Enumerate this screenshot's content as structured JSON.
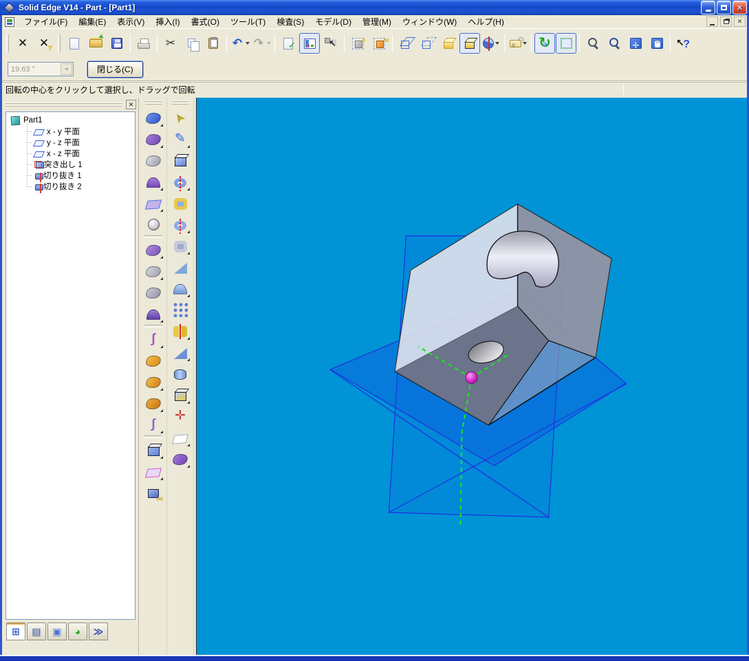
{
  "window": {
    "title": "Solid Edge V14 - Part - [Part1]",
    "controls": [
      "minimize",
      "maximize",
      "close"
    ]
  },
  "menu": {
    "items": [
      {
        "id": "file",
        "label": "ファイル(F)"
      },
      {
        "id": "edit",
        "label": "編集(E)"
      },
      {
        "id": "view",
        "label": "表示(V)"
      },
      {
        "id": "insert",
        "label": "挿入(I)"
      },
      {
        "id": "format",
        "label": "書式(O)"
      },
      {
        "id": "tools",
        "label": "ツール(T)"
      },
      {
        "id": "inspect",
        "label": "検査(S)"
      },
      {
        "id": "model",
        "label": "モデル(D)"
      },
      {
        "id": "manage",
        "label": "管理(M)"
      },
      {
        "id": "window",
        "label": "ウィンドウ(W)"
      },
      {
        "id": "help",
        "label": "ヘルプ(H)"
      }
    ],
    "mdi_controls": [
      "minimize",
      "restore",
      "close"
    ]
  },
  "toolbar": {
    "buttons": [
      {
        "n": "abort-command",
        "g": "✕",
        "c": "#111"
      },
      {
        "n": "abort-help",
        "g": "✕",
        "c": "#111",
        "sub": "?",
        "subc": "#D8A800"
      },
      {
        "grip": true
      },
      {
        "n": "new-document",
        "cls": "ic-new"
      },
      {
        "n": "open-document",
        "cls": "ic-open"
      },
      {
        "n": "save-document",
        "cls": "ic-save"
      },
      {
        "sep": true
      },
      {
        "n": "print",
        "cls": "ic-print"
      },
      {
        "sep": true
      },
      {
        "n": "cut",
        "g": "✂",
        "c": "#333"
      },
      {
        "n": "copy",
        "cls": "ic-copy"
      },
      {
        "n": "paste",
        "cls": "ic-paste"
      },
      {
        "sep": true
      },
      {
        "n": "undo",
        "g": "↶",
        "c": "#1f55d8",
        "dd": true
      },
      {
        "n": "redo",
        "g": "↷",
        "c": "#9b9b93",
        "dd": true,
        "disabled": true
      },
      {
        "sep": true
      },
      {
        "n": "document-check",
        "cls": "ic-doccheck"
      },
      {
        "n": "edgebar-toggle",
        "cls": "ic-edgebar",
        "pressed": true
      },
      {
        "n": "select-options",
        "cls": "ic-selboxes"
      },
      {
        "sep": true
      },
      {
        "n": "show-reference",
        "cls": "ic-showref"
      },
      {
        "n": "part-links",
        "cls": "ic-links"
      },
      {
        "sep": true
      },
      {
        "n": "wireframe-view",
        "cls": "ic-cubewire"
      },
      {
        "n": "hidden-line-view",
        "cls": "ic-cubehid"
      },
      {
        "n": "shaded-view",
        "cls": "ic-cubeshade"
      },
      {
        "n": "shaded-edges-view",
        "cls": "ic-cubeedges",
        "pressed": true
      },
      {
        "n": "section-view",
        "cls": "ic-section",
        "dd": true
      },
      {
        "sep": true
      },
      {
        "n": "callout",
        "cls": "ic-callout",
        "dd": true
      },
      {
        "sep": true
      },
      {
        "n": "rotate-view",
        "cls": "ic-rotate",
        "active": true
      },
      {
        "n": "view-orientation",
        "cls": "ic-vorient",
        "active": true
      },
      {
        "sep": true
      },
      {
        "n": "zoom-area",
        "cls": "ic-zoomarea"
      },
      {
        "n": "zoom",
        "cls": "ic-zoom"
      },
      {
        "n": "fit-view",
        "cls": "ic-fit"
      },
      {
        "n": "pan",
        "cls": "ic-pan"
      },
      {
        "sep": true
      },
      {
        "n": "help-pointer",
        "cls": "ic-help"
      }
    ]
  },
  "ribbon": {
    "angle_value": "19.63 °",
    "close_label": "閉じる(C)"
  },
  "prompt": {
    "text": "回転の中心をクリックして選択し、ドラッグで回転"
  },
  "edgebar": {
    "tree": {
      "root": "Part1",
      "items": [
        {
          "label": "x - y 平面",
          "icon": "plane"
        },
        {
          "label": "y - z 平面",
          "icon": "plane"
        },
        {
          "label": "x - z 平面",
          "icon": "plane"
        },
        {
          "label": "突き出し 1",
          "icon": "prot"
        },
        {
          "label": "切り抜き 1",
          "icon": "cut"
        },
        {
          "label": "切り抜き 2",
          "icon": "cut"
        }
      ]
    },
    "tabs": [
      {
        "n": "tab-pathfinder",
        "g": "⊞",
        "c": "#2f55c8",
        "active": true
      },
      {
        "n": "tab-library",
        "g": "▤",
        "c": "#2a3fa8"
      },
      {
        "n": "tab-family-of-parts",
        "g": "▣",
        "c": "#4f6fd8"
      },
      {
        "n": "tab-sensors",
        "g": "◕",
        "c": "#2aa82a"
      },
      {
        "n": "tab-playback",
        "g": "≫",
        "c": "#2a3fa8"
      }
    ]
  },
  "feature_toolbars": {
    "left": [
      {
        "n": "swept-surface",
        "shape": "surf",
        "c1": "#6f97ee",
        "c2": "#2f55c8",
        "dd": true
      },
      {
        "n": "lofted-surface",
        "shape": "surf",
        "c1": "#a87fe0",
        "c2": "#6f42b0",
        "dd": true
      },
      {
        "n": "bounded-surface",
        "shape": "surf",
        "c1": "#e2e2e8",
        "c2": "#9a9aa8"
      },
      {
        "n": "blend-surface",
        "shape": "dome",
        "c1": "#a87fe0",
        "c2": "#7448b8",
        "dd": true
      },
      {
        "n": "offset-surface",
        "shape": "plane",
        "c1": "#4f6fd8",
        "c2": "#c4b4ec",
        "dd": true
      },
      {
        "n": "construction-point",
        "shape": "sphere",
        "c1": "#cfcfd4",
        "c2": "#8f8f98"
      },
      {
        "sep": true
      },
      {
        "n": "delete-face",
        "shape": "surf",
        "c1": "#b08fe0",
        "c2": "#7a4fb8",
        "dd": true
      },
      {
        "n": "extend-surface",
        "shape": "surf",
        "c1": "#d8d8de",
        "c2": "#9f9fae",
        "dd": true
      },
      {
        "n": "replace-face",
        "shape": "surf",
        "c1": "#cfcfda",
        "c2": "#8f8fa0"
      },
      {
        "n": "stitched-surface",
        "shape": "dome",
        "c1": "#9f7fd8",
        "c2": "#5f3fa8",
        "dd": true
      },
      {
        "sep": true
      },
      {
        "n": "keypoint-curve",
        "shape": "curve",
        "g": "∫",
        "c1": "#b04fc8",
        "dd": true
      },
      {
        "n": "intersection-curve",
        "shape": "surf",
        "c1": "#f2bf4f",
        "c2": "#d8891a"
      },
      {
        "n": "projected-curve",
        "shape": "surf",
        "c1": "#f2bf4f",
        "c2": "#cf7f12",
        "dd": true
      },
      {
        "n": "cross-curve",
        "shape": "surf",
        "c1": "#efae3f",
        "c2": "#c87512",
        "dd": true
      },
      {
        "n": "split-curve",
        "shape": "curve",
        "g": "∫",
        "c1": "#8f5fd8",
        "dd": true
      },
      {
        "sep": true
      },
      {
        "n": "mirror-copy-body",
        "shape": "box",
        "c1": "#9fb8ef",
        "c2": "#5f7fd8",
        "dd": true
      },
      {
        "n": "pattern-body",
        "shape": "plane",
        "c1": "#cf4fd8",
        "c2": "#e8d8f2",
        "dd": true
      },
      {
        "n": "attach-part-copy",
        "shape": "chain",
        "c1": "#9fb8ef",
        "c2": "#4f66c8"
      }
    ],
    "right": [
      {
        "n": "select-tool",
        "shape": "arrow",
        "g": "➤",
        "c1": "#b8a82f"
      },
      {
        "n": "sketch",
        "shape": "pencil",
        "g": "✎",
        "c1": "#2f64d8",
        "dd": true
      },
      {
        "n": "protrusion",
        "shape": "box",
        "c1": "#b8d0f4",
        "c2": "#5f7fd8"
      },
      {
        "n": "revolved-protrusion",
        "shape": "donut",
        "c1": "#7f9fe8",
        "c2": "#3f5fc8",
        "dd": true
      },
      {
        "n": "cutout",
        "shape": "ring",
        "c1": "#e8c848",
        "c2": "#8faee8"
      },
      {
        "n": "revolved-cutout",
        "shape": "donut",
        "c1": "#8fa8e8",
        "c2": "#4f6fc8",
        "dd": true
      },
      {
        "n": "hole",
        "shape": "ring",
        "c1": "#c8cad8",
        "c2": "#9fa8c8",
        "dd": true
      },
      {
        "n": "draft",
        "shape": "wedge",
        "c1": "#7fa8d8",
        "c2": "#cfb87f"
      },
      {
        "n": "round",
        "shape": "dome",
        "c1": "#b8d4f4",
        "c2": "#6f97d8",
        "dd": true
      },
      {
        "n": "pattern",
        "shape": "pattern",
        "c1": "#5f7fd8",
        "c2": "#e8a848"
      },
      {
        "n": "mirror-feature",
        "shape": "mirror",
        "c1": "#e8c848",
        "c2": "#d8b82f",
        "dd": true
      },
      {
        "n": "rib",
        "shape": "wedge",
        "c1": "#6f8fd8",
        "c2": "#d84f4f",
        "dd": true
      },
      {
        "n": "boss",
        "shape": "cyl",
        "c1": "#b8d0f4",
        "c2": "#6f8fd8"
      },
      {
        "n": "thin-wall",
        "shape": "box",
        "c1": "#b8d0f4",
        "c2": "#e8c848",
        "dd": true
      },
      {
        "n": "coordinate-system",
        "shape": "axes",
        "g": "✛",
        "c1": "#c83f3f"
      },
      {
        "n": "reference-plane",
        "shape": "plane",
        "c1": "#9aa8b8",
        "c2": "#ffffff",
        "dd": true
      },
      {
        "n": "construction-display",
        "shape": "surf",
        "c1": "#a87fd8",
        "c2": "#6f42b0",
        "dd": true
      }
    ]
  },
  "viewport": {
    "background": "#0093D6",
    "plane_stroke": "#2030E0",
    "axis_color": "#1FE11F",
    "rotation_center_color": "#D126C4",
    "body_color": "#9A9AA8",
    "reference_planes": [
      "x - y 平面",
      "y - z 平面",
      "x - z 平面"
    ],
    "features_shown": [
      "突き出し 1",
      "切り抜き 1",
      "切り抜き 2"
    ]
  }
}
